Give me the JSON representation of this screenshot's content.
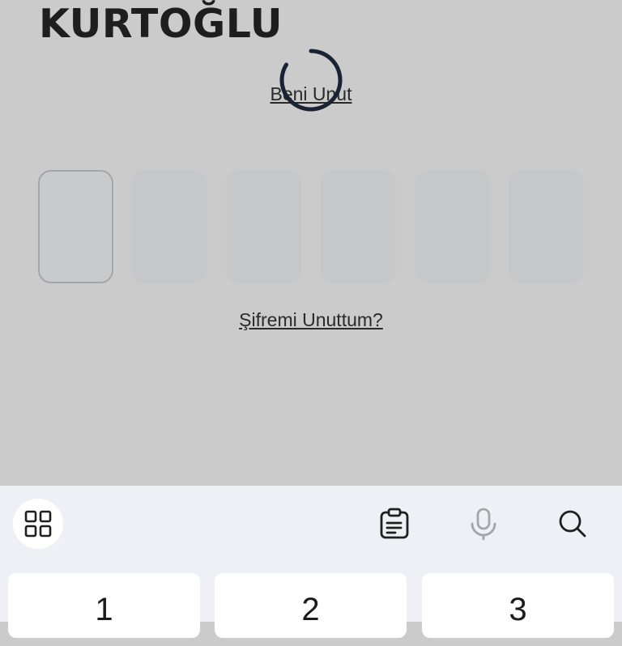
{
  "brand": {
    "name": "KURTOĞLU"
  },
  "links": {
    "forget_me": "Beni Unut",
    "forgot_password": "Şifremi Unuttum?"
  },
  "pin": {
    "length": 6,
    "active_index": 0
  },
  "keyboard": {
    "toolbar": {
      "grid_icon": "grid-icon",
      "clipboard_icon": "clipboard-icon",
      "mic_icon": "microphone-icon",
      "search_icon": "search-icon"
    },
    "keys": [
      "1",
      "2",
      "3"
    ]
  },
  "colors": {
    "overlay_bg": "#cbcbcc",
    "keyboard_bg": "#eef0f5",
    "spinner": "#1a2233"
  }
}
